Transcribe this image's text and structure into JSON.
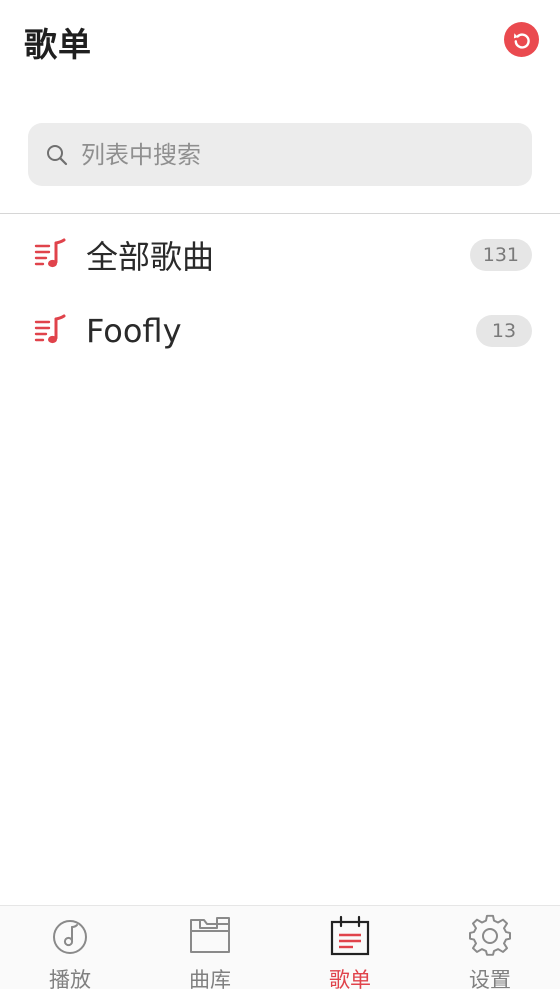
{
  "header": {
    "title": "歌单"
  },
  "colors": {
    "accent": "#ea4a4f",
    "badge_bg": "#e6e6e6",
    "search_bg": "#ececec"
  },
  "search": {
    "placeholder": "列表中搜索",
    "value": ""
  },
  "playlists": [
    {
      "name": "全部歌曲",
      "count": "131",
      "icon": "playlist-music-icon"
    },
    {
      "name": "Foofly",
      "count": "13",
      "icon": "playlist-music-icon"
    }
  ],
  "tabs": [
    {
      "label": "播放",
      "icon": "music-disc-icon",
      "active": false
    },
    {
      "label": "曲库",
      "icon": "folder-icon",
      "active": false
    },
    {
      "label": "歌单",
      "icon": "playlist-calendar-icon",
      "active": true
    },
    {
      "label": "设置",
      "icon": "gear-icon",
      "active": false
    }
  ]
}
